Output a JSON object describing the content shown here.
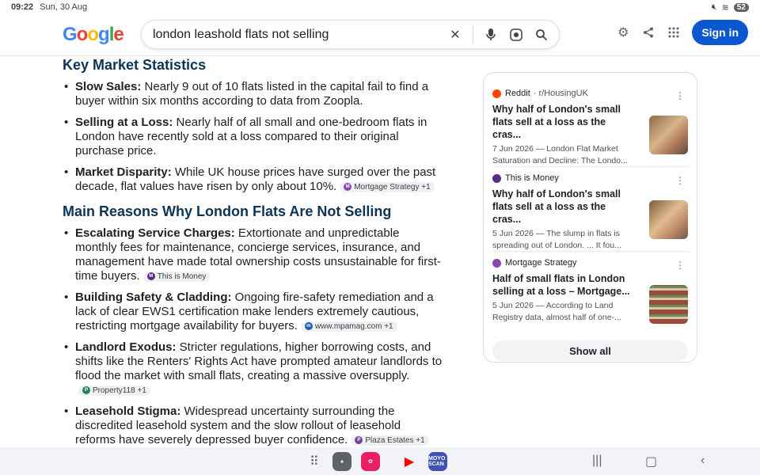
{
  "status": {
    "time": "09:22",
    "date": "Sun, 30 Aug",
    "battery": "52"
  },
  "search": {
    "query": "london leashold flats not selling",
    "sign_in": "Sign in"
  },
  "logo": {
    "g1": "G",
    "o1": "o",
    "o2": "o",
    "g2": "g",
    "l": "l",
    "e": "e"
  },
  "sections": [
    {
      "heading": "Key Market Statistics",
      "items": [
        {
          "lead": "Slow Sales:",
          "text": " Nearly 9 out of 10 flats listed in the capital fail to find a buyer within six months according to data from Zoopla.",
          "chip": ""
        },
        {
          "lead": "Selling at a Loss:",
          "text": " Nearly half of all small and one-bedroom flats in London have recently sold at a loss compared to their original purchase price.",
          "chip": ""
        },
        {
          "lead": "Market Disparity:",
          "text": " While UK house prices have surged over the past decade, flat values have risen by only about 10%.",
          "chip": "Mortgage Strategy +1"
        }
      ]
    },
    {
      "heading": "Main Reasons Why London Flats Are Not Selling",
      "items": [
        {
          "lead": "Escalating Service Charges:",
          "text": " Extortionate and unpredictable monthly fees for maintenance, concierge services, insurance, and management have made total ownership costs unsustainable for first-time buyers.",
          "chip": "This is Money"
        },
        {
          "lead": "Building Safety & Cladding:",
          "text": " Ongoing fire-safety remediation and a lack of clear EWS1 certification make lenders extremely cautious, restricting mortgage availability for buyers.",
          "chip": "www.mpamag.com +1"
        },
        {
          "lead": "Landlord Exodus:",
          "text": " Stricter regulations, higher borrowing costs, and shifts like the Renters' Rights Act have prompted amateur landlords to flood the market with small flats, creating a massive oversupply.",
          "chip": "Property118 +1"
        },
        {
          "lead": "Leasehold Stigma:",
          "text": " Widespread uncertainty surrounding the discredited leasehold system and the slow rollout of leasehold reforms have severely depressed buyer confidence.",
          "chip": "Plaza Estates +1"
        }
      ]
    }
  ],
  "panel": {
    "items": [
      {
        "source": "Reddit",
        "path": "· r/HousingUK",
        "title": "Why half of London's small flats sell at a loss as the cras...",
        "snippet": "7 Jun 2026 — London Flat Market Saturation and Decline: The Londo..."
      },
      {
        "source": "This is Money",
        "path": "",
        "title": "Why half of London's small flats sell at a loss as the cras...",
        "snippet": "5 Jun 2026 — The slump in flats is spreading out of London. ... It fou..."
      },
      {
        "source": "Mortgage Strategy",
        "path": "",
        "title": "Half of small flats in London selling at a loss – Mortgage...",
        "snippet": "5 Jun 2026 — According to Land Registry data, almost half of one-..."
      }
    ],
    "show_all": "Show all"
  },
  "navbar": {
    "moyo_label": "MOYO SCAN"
  },
  "colors": {
    "accent": "#0b57d0",
    "heading": "#0b3455"
  }
}
